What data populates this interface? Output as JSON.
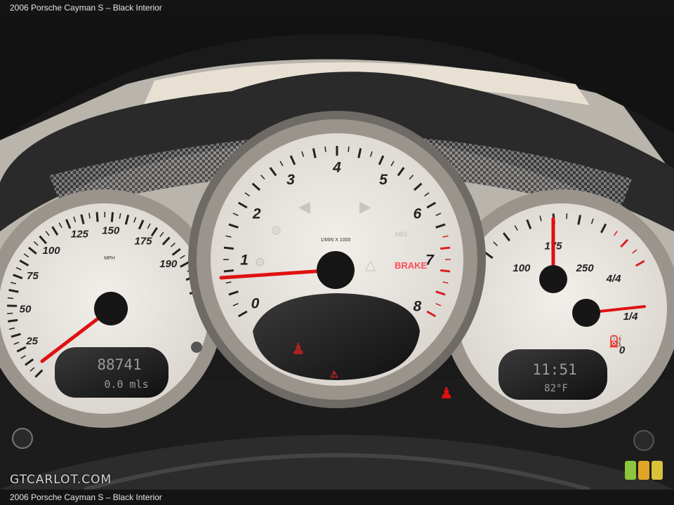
{
  "caption": {
    "top": "2006 Porsche Cayman S – Black Interior",
    "bottom": "2006 Porsche Cayman S – Black Interior"
  },
  "watermark": "GTCARLOT.COM",
  "logo_colors": [
    "#8cc63f",
    "#e0a526",
    "#d8c23a"
  ],
  "speedometer": {
    "labels": [
      "25",
      "50",
      "75",
      "100",
      "125",
      "150",
      "175",
      "190"
    ],
    "unit": "MPH",
    "odometer": "88741",
    "trip": "0.0 mls",
    "reading": 0
  },
  "tachometer": {
    "labels": [
      "0",
      "1",
      "2",
      "3",
      "4",
      "5",
      "6",
      "7",
      "8"
    ],
    "unit": "1/MIN X 1000",
    "abs_label": "ABS",
    "brake_label": "BRAKE",
    "reading": 1.0
  },
  "right_gauge": {
    "temp_labels": [
      "100",
      "175",
      "250"
    ],
    "fuel_labels": [
      "0",
      "1/4",
      "4/4"
    ],
    "clock": "11:51",
    "outside_temp": "82°F"
  },
  "colors": {
    "needle": "#e01010",
    "dial_face": "#ece9e4",
    "bezel": "#8a8580"
  }
}
